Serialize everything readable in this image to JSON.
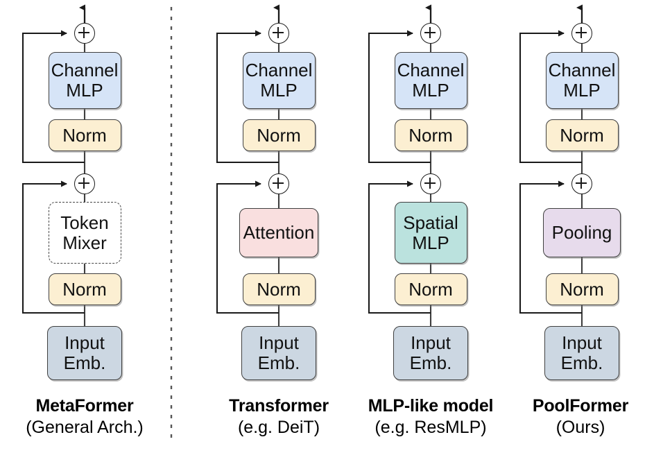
{
  "figure": {
    "type": "architecture-diagram",
    "divider": "dashed-vertical-separator",
    "operator_symbol": "+"
  },
  "palette": {
    "channel_mlp": "#d6e4f7",
    "norm": "#fcefd2",
    "input_emb": "#ccd7e2",
    "token_mixer": "#ffffff",
    "attention": "#f9dfdf",
    "spatial_mlp": "#bbe2de",
    "pooling": "#e7dbec",
    "stroke": "#3f3f3f",
    "text": "#111111"
  },
  "columns": [
    {
      "id": "metaformer",
      "caption": {
        "title": "MetaFormer",
        "subtitle": "(General Arch.)"
      },
      "blocks": {
        "channel_mlp": {
          "lines": [
            "Channel",
            "MLP"
          ],
          "color": "#d6e4f7",
          "style": "solid"
        },
        "norm_top": {
          "lines": [
            "Norm"
          ],
          "color": "#fcefd2",
          "style": "solid"
        },
        "mixer": {
          "lines": [
            "Token",
            "Mixer"
          ],
          "color": "#ffffff",
          "style": "dashed"
        },
        "norm_bottom": {
          "lines": [
            "Norm"
          ],
          "color": "#fcefd2",
          "style": "solid"
        },
        "input_emb": {
          "lines": [
            "Input",
            "Emb."
          ],
          "color": "#ccd7e2",
          "style": "solid"
        }
      }
    },
    {
      "id": "transformer",
      "caption": {
        "title": "Transformer",
        "subtitle": "(e.g. DeiT)"
      },
      "blocks": {
        "channel_mlp": {
          "lines": [
            "Channel",
            "MLP"
          ],
          "color": "#d6e4f7",
          "style": "solid"
        },
        "norm_top": {
          "lines": [
            "Norm"
          ],
          "color": "#fcefd2",
          "style": "solid"
        },
        "mixer": {
          "lines": [
            "Attention"
          ],
          "color": "#f9dfdf",
          "style": "solid"
        },
        "norm_bottom": {
          "lines": [
            "Norm"
          ],
          "color": "#fcefd2",
          "style": "solid"
        },
        "input_emb": {
          "lines": [
            "Input",
            "Emb."
          ],
          "color": "#ccd7e2",
          "style": "solid"
        }
      }
    },
    {
      "id": "mlp-like-model",
      "caption": {
        "title": "MLP-like model",
        "subtitle": "(e.g. ResMLP)"
      },
      "blocks": {
        "channel_mlp": {
          "lines": [
            "Channel",
            "MLP"
          ],
          "color": "#d6e4f7",
          "style": "solid"
        },
        "norm_top": {
          "lines": [
            "Norm"
          ],
          "color": "#fcefd2",
          "style": "solid"
        },
        "mixer": {
          "lines": [
            "Spatial",
            "MLP"
          ],
          "color": "#bbe2de",
          "style": "solid"
        },
        "norm_bottom": {
          "lines": [
            "Norm"
          ],
          "color": "#fcefd2",
          "style": "solid"
        },
        "input_emb": {
          "lines": [
            "Input",
            "Emb."
          ],
          "color": "#ccd7e2",
          "style": "solid"
        }
      }
    },
    {
      "id": "poolformer",
      "caption": {
        "title": "PoolFormer",
        "subtitle": "(Ours)"
      },
      "blocks": {
        "channel_mlp": {
          "lines": [
            "Channel",
            "MLP"
          ],
          "color": "#d6e4f7",
          "style": "solid"
        },
        "norm_top": {
          "lines": [
            "Norm"
          ],
          "color": "#fcefd2",
          "style": "solid"
        },
        "mixer": {
          "lines": [
            "Pooling"
          ],
          "color": "#e7dbec",
          "style": "solid"
        },
        "norm_bottom": {
          "lines": [
            "Norm"
          ],
          "color": "#fcefd2",
          "style": "solid"
        },
        "input_emb": {
          "lines": [
            "Input",
            "Emb."
          ],
          "color": "#ccd7e2",
          "style": "solid"
        }
      }
    }
  ]
}
